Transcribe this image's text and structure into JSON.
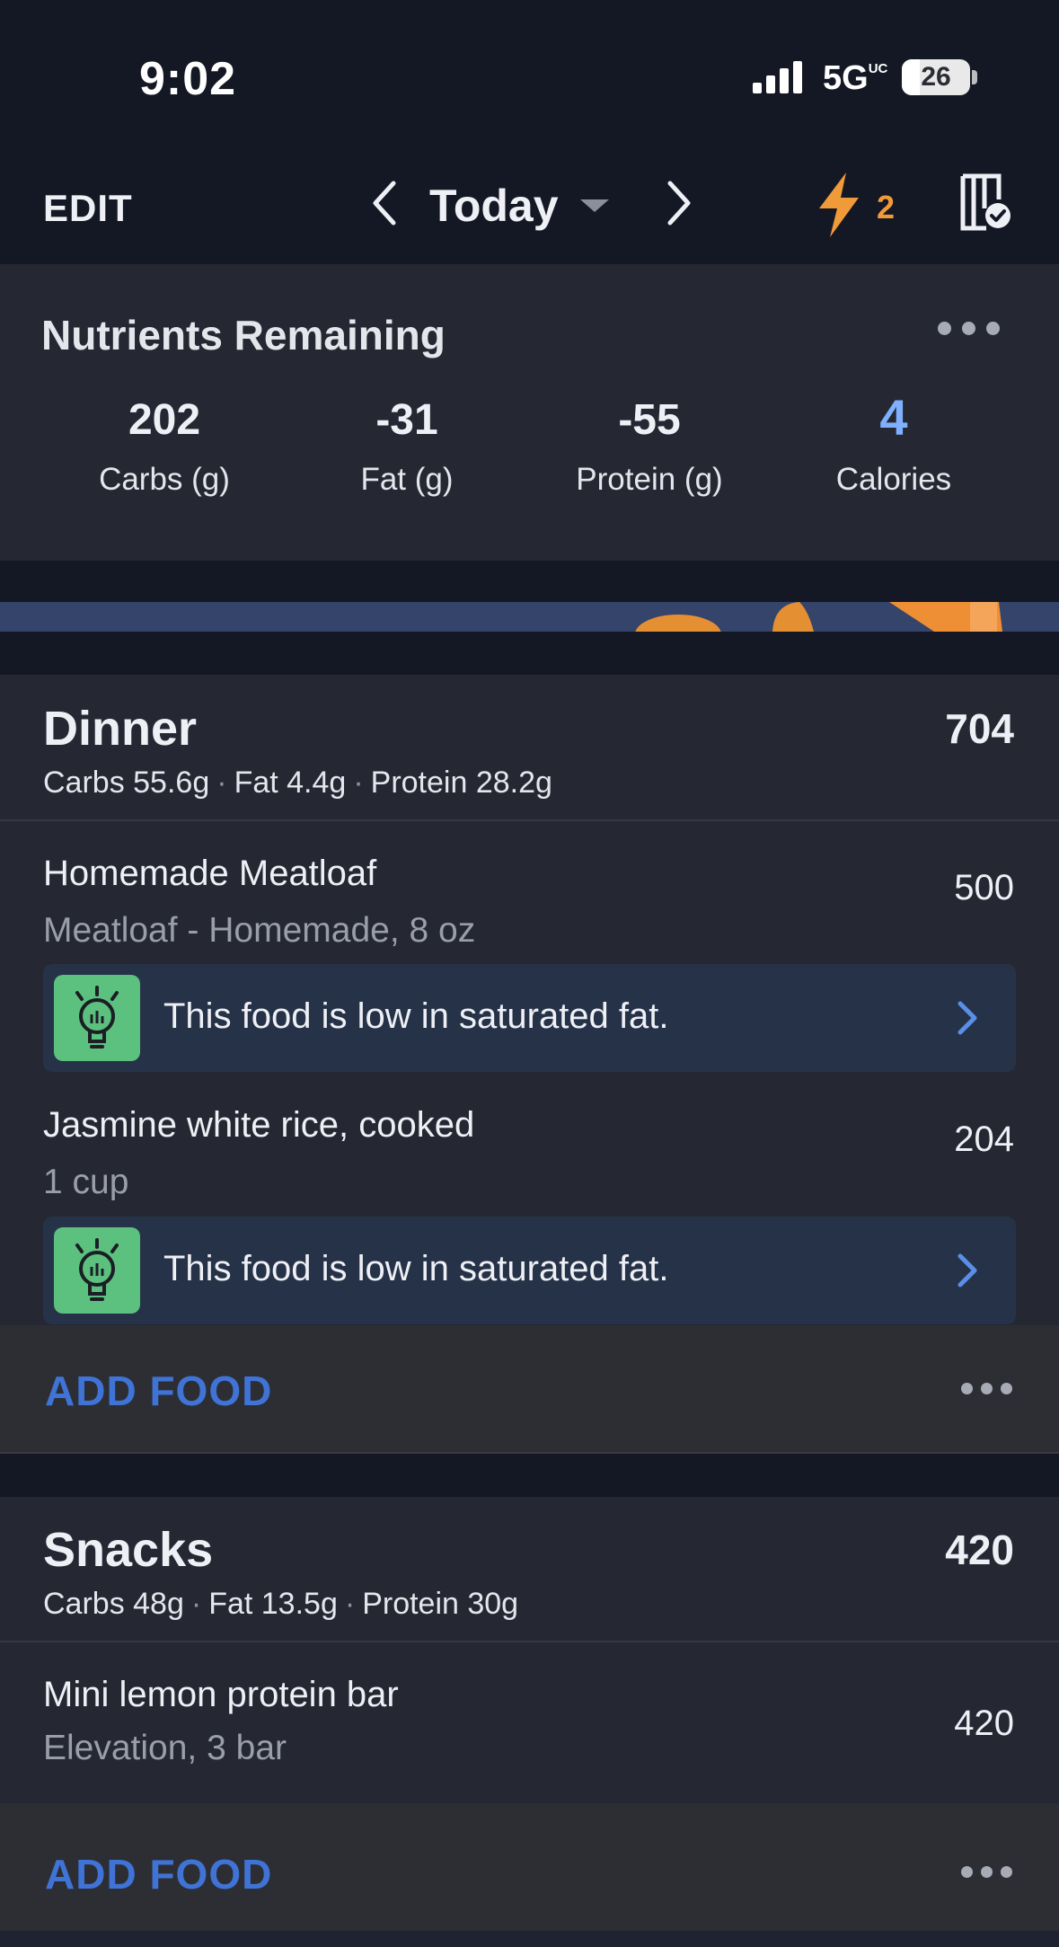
{
  "status_bar": {
    "time": "9:02",
    "network": "5G",
    "network_suffix": "UC",
    "battery": "26"
  },
  "nav": {
    "edit_label": "EDIT",
    "date_label": "Today",
    "streak_count": "2"
  },
  "nutrients": {
    "title": "Nutrients Remaining",
    "items": [
      {
        "value": "202",
        "label": "Carbs (g)"
      },
      {
        "value": "-31",
        "label": "Fat (g)"
      },
      {
        "value": "-55",
        "label": "Protein (g)"
      },
      {
        "value": "4",
        "label": "Calories"
      }
    ]
  },
  "dinner": {
    "title": "Dinner",
    "calories": "704",
    "macros": {
      "carbs": "Carbs 55.6g",
      "fat": "Fat 4.4g",
      "protein": "Protein 28.2g"
    },
    "foods": [
      {
        "name": "Homemade Meatloaf",
        "detail": "Meatloaf - Homemade, 8 oz",
        "calories": "500",
        "tip": "This food is low in saturated fat."
      },
      {
        "name": "Jasmine white rice, cooked",
        "detail": "1 cup",
        "calories": "204",
        "tip": "This food is low in saturated fat."
      }
    ],
    "add_label": "ADD FOOD"
  },
  "snacks": {
    "title": "Snacks",
    "calories": "420",
    "macros": {
      "carbs": "Carbs 48g",
      "fat": "Fat 13.5g",
      "protein": "Protein 30g"
    },
    "foods": [
      {
        "name": "Mini lemon protein bar",
        "detail": "Elevation, 3 bar",
        "calories": "420"
      }
    ],
    "add_label": "ADD FOOD"
  },
  "colors": {
    "background": "#141824",
    "panel": "#252833",
    "accent_blue": "#3f73d6",
    "calories_blue": "#7fb0ff",
    "streak_orange": "#f19a3a",
    "tip_green": "#5cc07e"
  }
}
